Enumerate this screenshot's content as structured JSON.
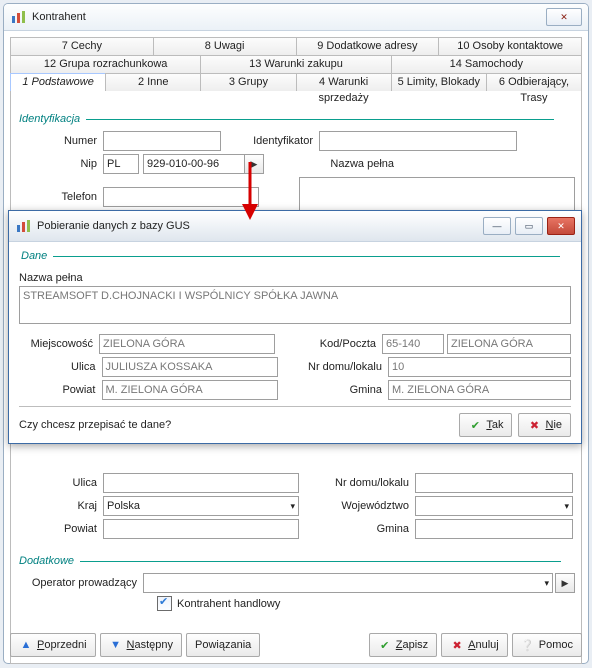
{
  "window": {
    "title": "Kontrahent",
    "close_glyph": "✕"
  },
  "tabs": {
    "row1": [
      "7 Cechy",
      "8 Uwagi",
      "9 Dodatkowe adresy",
      "10 Osoby kontaktowe"
    ],
    "row2": [
      "12 Grupa rozrachunkowa",
      "13 Warunki zakupu",
      "14 Samochody"
    ],
    "row3": [
      "1 Podstawowe",
      "2 Inne",
      "3 Grupy",
      "4 Warunki sprzedaży",
      "5 Limity, Blokady",
      "6 Odbierający, Trasy"
    ]
  },
  "group": {
    "ident": "Identyfikacja",
    "dodat": "Dodatkowe",
    "dane": "Dane"
  },
  "fields": {
    "numer": "Numer",
    "identyfikator": "Identyfikator",
    "nip": "Nip",
    "nazwa_pelna": "Nazwa pełna",
    "telefon": "Telefon",
    "ulica": "Ulica",
    "nr_domu": "Nr domu/lokalu",
    "kraj": "Kraj",
    "wojewodztwo": "Województwo",
    "powiat": "Powiat",
    "gmina": "Gmina",
    "operator": "Operator prowadzący"
  },
  "values": {
    "nip_cc": "PL",
    "nip_num": "929-010-00-96",
    "kraj": "Polska",
    "kontrahent_handlowy": "Kontrahent handlowy"
  },
  "modal": {
    "title": "Pobieranie danych z bazy GUS",
    "labels": {
      "nazwa_pelna": "Nazwa pełna",
      "miejscowosc": "Miejscowość",
      "kod_poczta": "Kod/Poczta",
      "ulica": "Ulica",
      "nr_domu": "Nr domu/lokalu",
      "powiat": "Powiat",
      "gmina": "Gmina"
    },
    "values": {
      "nazwa_pelna": "STREAMSOFT D.CHOJNACKI I WSPÓLNICY SPÓŁKA JAWNA",
      "miejscowosc": "ZIELONA GÓRA",
      "kod": "65-140",
      "poczta": "ZIELONA GÓRA",
      "ulica": "JULIUSZA KOSSAKA",
      "nr_domu": "10",
      "powiat": "M. ZIELONA GÓRA",
      "gmina": "M. ZIELONA GÓRA"
    },
    "confirm_q": "Czy chcesz przepisać te dane?",
    "yes_pre": "T",
    "yes_rest": "ak",
    "no_pre": "N",
    "no_rest": "ie"
  },
  "buttons": {
    "poprzedni_pre": "P",
    "poprzedni_rest": "oprzedni",
    "nastepny_pre": "N",
    "nastepny_rest": "astępny",
    "powiazania": "Powiązania",
    "zapisz_pre": "Z",
    "zapisz_rest": "apisz",
    "anuluj_pre": "A",
    "anuluj_rest": "nuluj",
    "pomoc": "Pomoc"
  },
  "icons": {
    "min": "—",
    "max": "▭",
    "close": "✕",
    "chev": "▾",
    "play": "▶"
  }
}
